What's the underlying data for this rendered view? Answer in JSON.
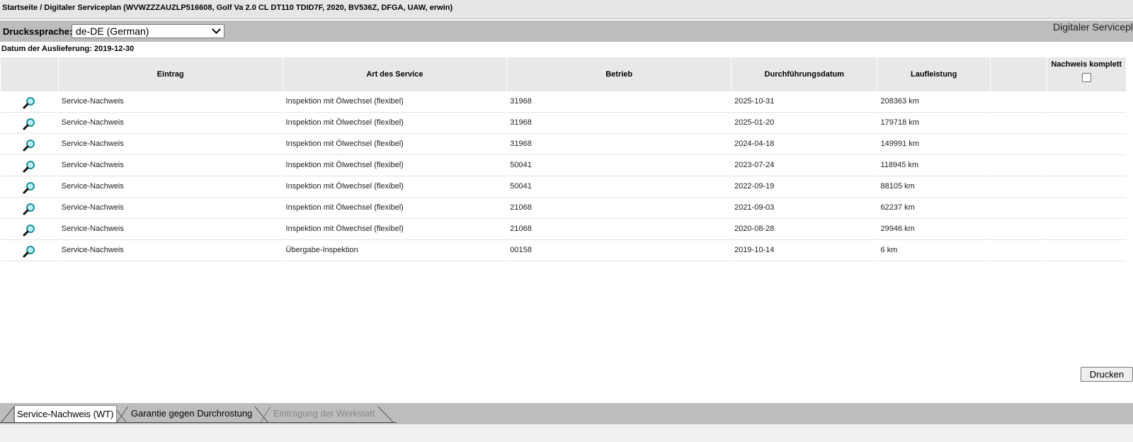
{
  "breadcrumb": "Startseite / Digitaler Serviceplan (WVWZZZAUZLP516608, Golf Va 2.0 CL DT110 TDID7F, 2020, BV536Z, DFGA, UAW, erwin)",
  "print_language": {
    "label": "Druckssprache:",
    "selected": "de-DE (German)"
  },
  "page_heading": "Digitaler Servicepl",
  "delivery_date": "Datum der Auslieferung: 2019-12-30",
  "table": {
    "headers": [
      "Eintrag",
      "Art des Service",
      "Betrieb",
      "Durchführungsdatum",
      "Laufleistung",
      "Nachweis komplett"
    ],
    "rows": [
      {
        "eintrag": "Service-Nachweis",
        "art": "Inspektion mit Ölwechsel (flexibel)",
        "betrieb": "31968",
        "datum": "2025-10-31",
        "laufleistung": "208363 km"
      },
      {
        "eintrag": "Service-Nachweis",
        "art": "Inspektion mit Ölwechsel (flexibel)",
        "betrieb": "31968",
        "datum": "2025-01-20",
        "laufleistung": "179718 km"
      },
      {
        "eintrag": "Service-Nachweis",
        "art": "Inspektion mit Ölwechsel (flexibel)",
        "betrieb": "31968",
        "datum": "2024-04-18",
        "laufleistung": "149991 km"
      },
      {
        "eintrag": "Service-Nachweis",
        "art": "Inspektion mit Ölwechsel (flexibel)",
        "betrieb": "50041",
        "datum": "2023-07-24",
        "laufleistung": "118945 km"
      },
      {
        "eintrag": "Service-Nachweis",
        "art": "Inspektion mit Ölwechsel (flexibel)",
        "betrieb": "50041",
        "datum": "2022-09-19",
        "laufleistung": "88105 km"
      },
      {
        "eintrag": "Service-Nachweis",
        "art": "Inspektion mit Ölwechsel (flexibel)",
        "betrieb": "21068",
        "datum": "2021-09-03",
        "laufleistung": "62237 km"
      },
      {
        "eintrag": "Service-Nachweis",
        "art": "Inspektion mit Ölwechsel (flexibel)",
        "betrieb": "21068",
        "datum": "2020-08-28",
        "laufleistung": "29946 km"
      },
      {
        "eintrag": "Service-Nachweis",
        "art": "Übergabe-Inspektion",
        "betrieb": "00158",
        "datum": "2019-10-14",
        "laufleistung": "6 km"
      }
    ]
  },
  "print_button": "Drucken",
  "tabs": [
    {
      "label": "Service-Nachweis (WT)",
      "state": "active"
    },
    {
      "label": "Garantie gegen Durchrostung",
      "state": "normal"
    },
    {
      "label": "Eintragung der Werkstatt",
      "state": "disabled"
    }
  ],
  "colors": {
    "icon": "#1a8f9c",
    "header_bg": "#e8e8e8",
    "bar_bg": "#bdbdbd"
  }
}
